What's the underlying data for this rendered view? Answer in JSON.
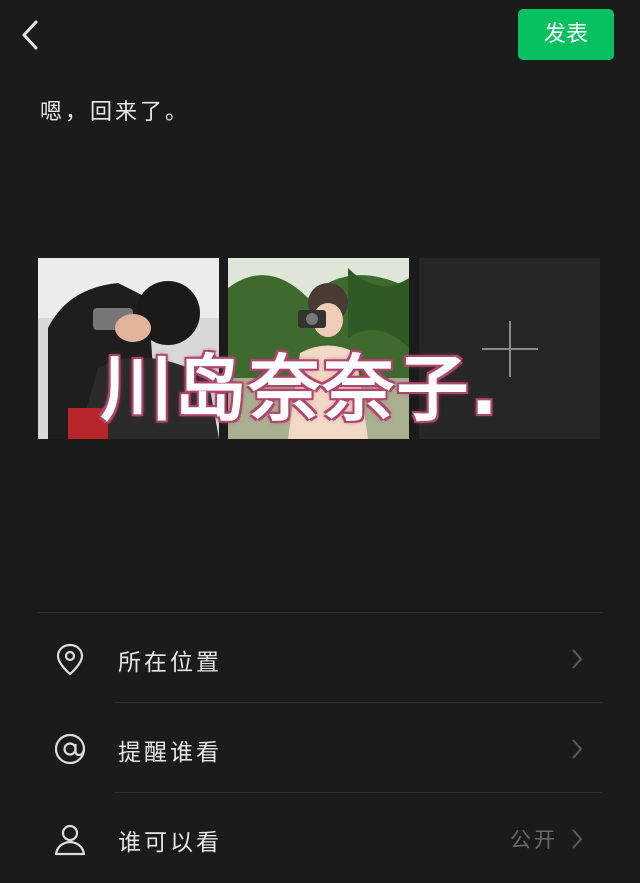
{
  "header": {
    "publish_label": "发表"
  },
  "post": {
    "text": "嗯，回来了。"
  },
  "overlay": {
    "text": "川岛奈奈子."
  },
  "colors": {
    "accent": "#07c160",
    "background": "#1b1b1b",
    "overlay_outline": "#b0466f"
  },
  "photos": [
    {
      "icon": "photo-thumbnail"
    },
    {
      "icon": "photo-thumbnail"
    }
  ],
  "add_photo": {
    "icon": "plus-icon"
  },
  "options": [
    {
      "icon": "location-pin-icon",
      "label": "所在位置",
      "value": ""
    },
    {
      "icon": "at-icon",
      "label": "提醒谁看",
      "value": ""
    },
    {
      "icon": "person-icon",
      "label": "谁可以看",
      "value": "公开"
    }
  ]
}
